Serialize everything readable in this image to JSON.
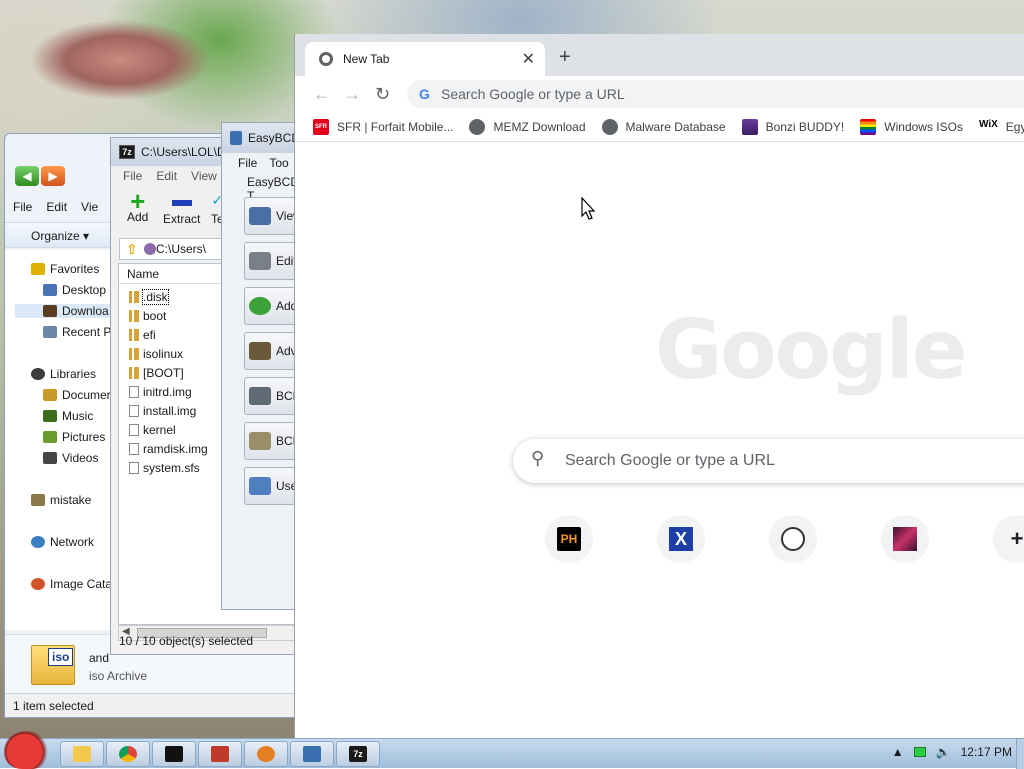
{
  "explorer": {
    "menu": [
      "File",
      "Edit",
      "Vie"
    ],
    "organize_label": "Organize",
    "nav_items": [
      {
        "label": "Favorites",
        "color": "#e0b100"
      },
      {
        "label": "Desktop",
        "color": "#4c73b5"
      },
      {
        "label": "Downloa",
        "color": "#5a3d1e"
      },
      {
        "label": "Recent P",
        "color": "#6d85a8"
      },
      {
        "label": "Libraries",
        "color": "#3c3c3c"
      },
      {
        "label": "Documer",
        "color": "#c89a2a"
      },
      {
        "label": "Music",
        "color": "#3f6d1e"
      },
      {
        "label": "Pictures",
        "color": "#6b9b2a"
      },
      {
        "label": "Videos",
        "color": "#444444"
      },
      {
        "label": "mistake",
        "color": "#8a7a4a"
      },
      {
        "label": "Network",
        "color": "#3a7fc4"
      },
      {
        "label": "Image Cata",
        "color": "#d0542a"
      }
    ],
    "details": {
      "filename": "and",
      "filetype": "iso Archive",
      "icon_text": "iso"
    },
    "status": "1 item selected"
  },
  "sevenzip": {
    "title": "C:\\Users\\LOL\\D",
    "icon_text": "7z",
    "menu": [
      "File",
      "Edit",
      "View"
    ],
    "toolbar": {
      "add": "Add",
      "extract": "Extract",
      "test": "Te"
    },
    "address": "C:\\Users\\",
    "column_name": "Name",
    "files": [
      {
        "name": ".disk",
        "type": "folder"
      },
      {
        "name": "boot",
        "type": "folder"
      },
      {
        "name": "efi",
        "type": "folder"
      },
      {
        "name": "isolinux",
        "type": "folder"
      },
      {
        "name": "[BOOT]",
        "type": "folder"
      },
      {
        "name": "initrd.img",
        "type": "file"
      },
      {
        "name": "install.img",
        "type": "file"
      },
      {
        "name": "kernel",
        "type": "file"
      },
      {
        "name": "ramdisk.img",
        "type": "file"
      },
      {
        "name": "system.sfs",
        "type": "file"
      }
    ],
    "status": "10 / 10 object(s) selected"
  },
  "easybcd": {
    "title": "EasyBCD",
    "menu": [
      "File",
      "Too"
    ],
    "group": "EasyBCD T",
    "buttons": [
      {
        "label": "View",
        "color": "#4a6fa5"
      },
      {
        "label": "Edit",
        "color": "#7a8088"
      },
      {
        "label": "Add",
        "color": "#3da13a"
      },
      {
        "label": "Adv",
        "color": "#6b5a3a"
      },
      {
        "label": "BCD",
        "color": "#5f6a75"
      },
      {
        "label": "BCD",
        "color": "#9a8f6b"
      },
      {
        "label": "Use",
        "color": "#4f7fbf"
      }
    ]
  },
  "chrome": {
    "tab_title": "New Tab",
    "omnibox_placeholder": "Search Google or type a URL",
    "bookmarks": [
      {
        "label": "SFR | Forfait Mobile...",
        "icon": "sfr"
      },
      {
        "label": "MEMZ Download",
        "icon": "globe"
      },
      {
        "label": "Malware Database",
        "icon": "globe"
      },
      {
        "label": "Bonzi BUDDY!",
        "icon": "bonzi"
      },
      {
        "label": "Windows ISOs",
        "icon": "rainbow"
      },
      {
        "label": "Egypti",
        "icon": "wix"
      }
    ],
    "logo_text": "Google",
    "ntp_search_placeholder": "Search Google or type a URL",
    "shortcuts": [
      {
        "text": "PH",
        "bg": "#000000",
        "fg": "#f7971d"
      },
      {
        "text": "X",
        "bg": "#1e3fa8",
        "fg": "#ffffff"
      },
      {
        "text": "",
        "bg": "#ffffff",
        "fg": "#000000"
      },
      {
        "text": "",
        "bg": "#8b1e4a",
        "fg": "#ffffff"
      },
      {
        "text": "+",
        "bg": "#f1f3f4",
        "fg": "#202124"
      }
    ]
  },
  "taskbar": {
    "clock": "12:17 PM",
    "items": [
      "explorer",
      "chrome",
      "cmd",
      "app",
      "browser",
      "easybcd",
      "7zip"
    ]
  }
}
